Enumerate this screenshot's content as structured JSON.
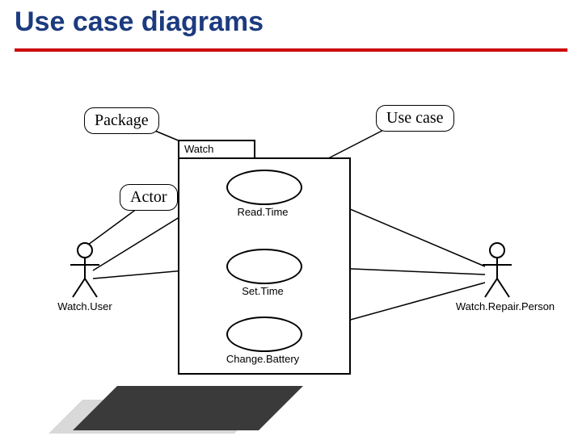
{
  "title": "Use case diagrams",
  "callouts": {
    "package": "Package",
    "usecase": "Use case",
    "actor": "Actor"
  },
  "package_name": "Watch",
  "usecases": {
    "read": "Read.Time",
    "set": "Set.Time",
    "change": "Change.Battery"
  },
  "actors": {
    "left": "Watch.User",
    "right": "Watch.Repair.Person"
  }
}
